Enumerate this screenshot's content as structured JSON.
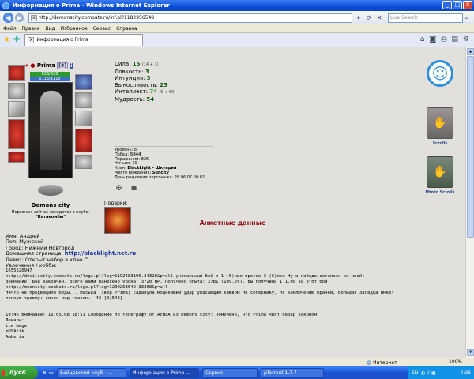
{
  "window": {
    "title": "Информация о Prima - Windows Internet Explorer"
  },
  "address_bar": {
    "url": "http://demonscity.combats.ru/inf.pl?1182956548",
    "search_placeholder": "Live Search"
  },
  "menu": [
    "Файл",
    "Правка",
    "Вид",
    "Избранное",
    "Сервис",
    "Справка"
  ],
  "tab": {
    "label": "Информация о Prima"
  },
  "character": {
    "name": "Prima",
    "level": "[8]",
    "info_badge": "i",
    "hp": "636/636",
    "mp": "1115/1115",
    "clan_city": "Demons city",
    "location_text": "Персонаж сейчас находится в клубе.",
    "location_place": "\"Катакомбы\""
  },
  "stats": {
    "strength_label": "Сила: ",
    "strength": "15",
    "strength_bonus": "(14 + 1)",
    "agility_label": "Ловкость: ",
    "agility": "3",
    "intuition_label": "Интуиция: ",
    "intuition": "3",
    "endurance_label": "Выносливость: ",
    "endurance": "25",
    "intellect_label": "Интеллект: ",
    "intellect": "74",
    "intellect_bonus": "(5 + 69)",
    "wisdom_label": "Мудрость: ",
    "wisdom": "54"
  },
  "info": {
    "level_label": "Уровень: ",
    "level": "8",
    "wins_label": "Побед: ",
    "wins": "5044",
    "losses_label": "Поражений: ",
    "losses": "826",
    "draws_label": "Ничьих: ",
    "draws": "19",
    "clan_label": "Клан: ",
    "clan": "BlackLight - Шкуприй",
    "birthplace_label": "Место рождения: ",
    "birthplace": "Suncity",
    "birthday_label": "День рождения персонажа: ",
    "birthday": "28.06.07 00:02"
  },
  "gifts_label": "Подарки:",
  "right_icons": {
    "scrolls_label": "Scrolls",
    "photo_scrolls_label": "Photo Scrolls"
  },
  "profile": {
    "section_title": "Анкетные данные",
    "name_line": "Имя: Андрей",
    "sex_line": "Пол: Мужской",
    "city_line": "Город: Нижний Новгород",
    "homepage_label": "Домашняя страница: ",
    "homepage": "http://blacklight.net.ru",
    "motto_line": "Девиз: Открыт набор в клан ™",
    "hobbies_label": "Увлечения / хобби:",
    "lines": [
      "1655520947",
      "http://devilscity.combats.ru/logs.pl?log=1192483196.34328&p=all уникальный бой я 1 (6)лвл против 3 (6)лвл Ну и победа осталась за мной)",
      "Внимание! Бой закончен. Всего вами нанесено урона: 3720 HP. Получено опыта: 2781 (109.2%). Вы получили 1 1.00 за этот бой",
      "http://mooncity.combats.ru/logs.pl?log=1200263642.33368&p=all",
      "Ничто не предвещало беды... Наська (звер Prima) саданула мощнейший удар ужасающим клювом по сопернику, по заключению врачей, Большая Загадка имеет",
      "легкую травму: синяк под глазом. -42 [0/542]"
    ],
    "lines2": [
      "19:46 Внимание! 16.05.08 18:51 Сообщение по телеграфу от AcHaA из Demons city: Помечено, что Prima чист перед законом",
      "Лекари:",
      "ice mage",
      "mUSAtik",
      "Amberia"
    ]
  },
  "statusbar": {
    "zone": "Интернет",
    "zoom": "100%"
  },
  "taskbar": {
    "start": "пуск",
    "tasks": [
      "Бойцовский клуб - ...",
      "Информация о Prima ...",
      "Сервис",
      "µTorrent 1.7.7"
    ],
    "lang": "EN",
    "clock": "2:36"
  }
}
